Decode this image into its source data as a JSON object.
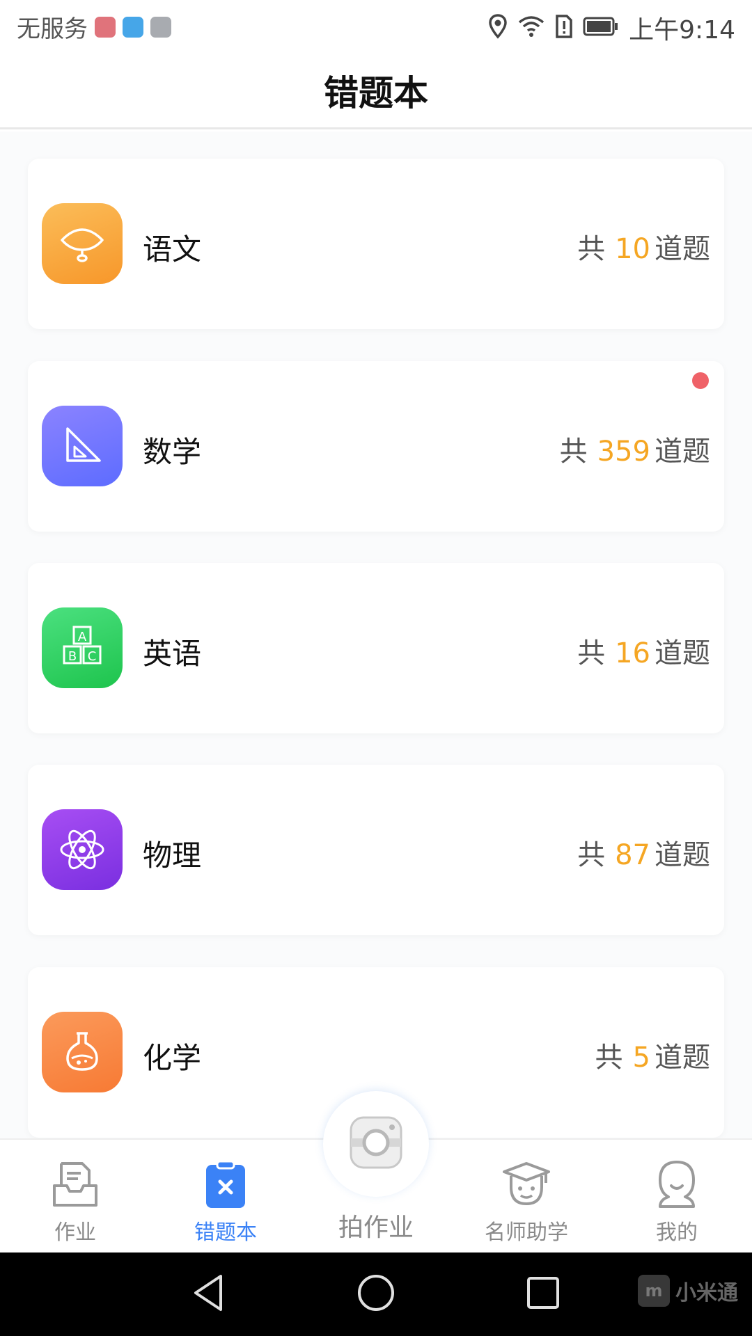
{
  "status_bar": {
    "carrier": "无服务",
    "time": "上午9:14",
    "app_icons": [
      "vmall-icon",
      "health-icon",
      "message-icon"
    ],
    "indicator_icons": [
      "location-icon",
      "wifi-icon",
      "sim-alert-icon",
      "battery-icon"
    ]
  },
  "header": {
    "title": "错题本"
  },
  "subjects": [
    {
      "name": "语文",
      "prefix": "共",
      "count": "10",
      "suffix": "道题",
      "icon": "fan-icon",
      "color": "#f7a33a",
      "has_new": false
    },
    {
      "name": "数学",
      "prefix": "共",
      "count": "359",
      "suffix": "道题",
      "icon": "set-square-icon",
      "color": "#6d77ff",
      "has_new": true
    },
    {
      "name": "英语",
      "prefix": "共",
      "count": "16",
      "suffix": "道题",
      "icon": "abc-blocks-icon",
      "color": "#2bd160",
      "has_new": false
    },
    {
      "name": "物理",
      "prefix": "共",
      "count": "87",
      "suffix": "道题",
      "icon": "atom-icon",
      "color": "#8f3eea",
      "has_new": false
    },
    {
      "name": "化学",
      "prefix": "共",
      "count": "5",
      "suffix": "道题",
      "icon": "flask-icon",
      "color": "#f9893f",
      "has_new": false
    }
  ],
  "tabs": [
    {
      "label": "作业",
      "icon": "homework-tray-icon",
      "active": false
    },
    {
      "label": "错题本",
      "icon": "error-book-icon",
      "active": true
    },
    {
      "label": "拍作业",
      "icon": "camera-icon",
      "active": false
    },
    {
      "label": "名师助学",
      "icon": "teacher-cap-icon",
      "active": false
    },
    {
      "label": "我的",
      "icon": "profile-icon",
      "active": false
    }
  ],
  "colors": {
    "accent": "#3b82f6",
    "count_highlight": "#f5a623",
    "new_dot": "#ef6268"
  },
  "system_nav": {
    "buttons": [
      "back-icon",
      "home-icon",
      "recents-icon"
    ],
    "watermark": "小米通",
    "watermark_logo": "m"
  }
}
